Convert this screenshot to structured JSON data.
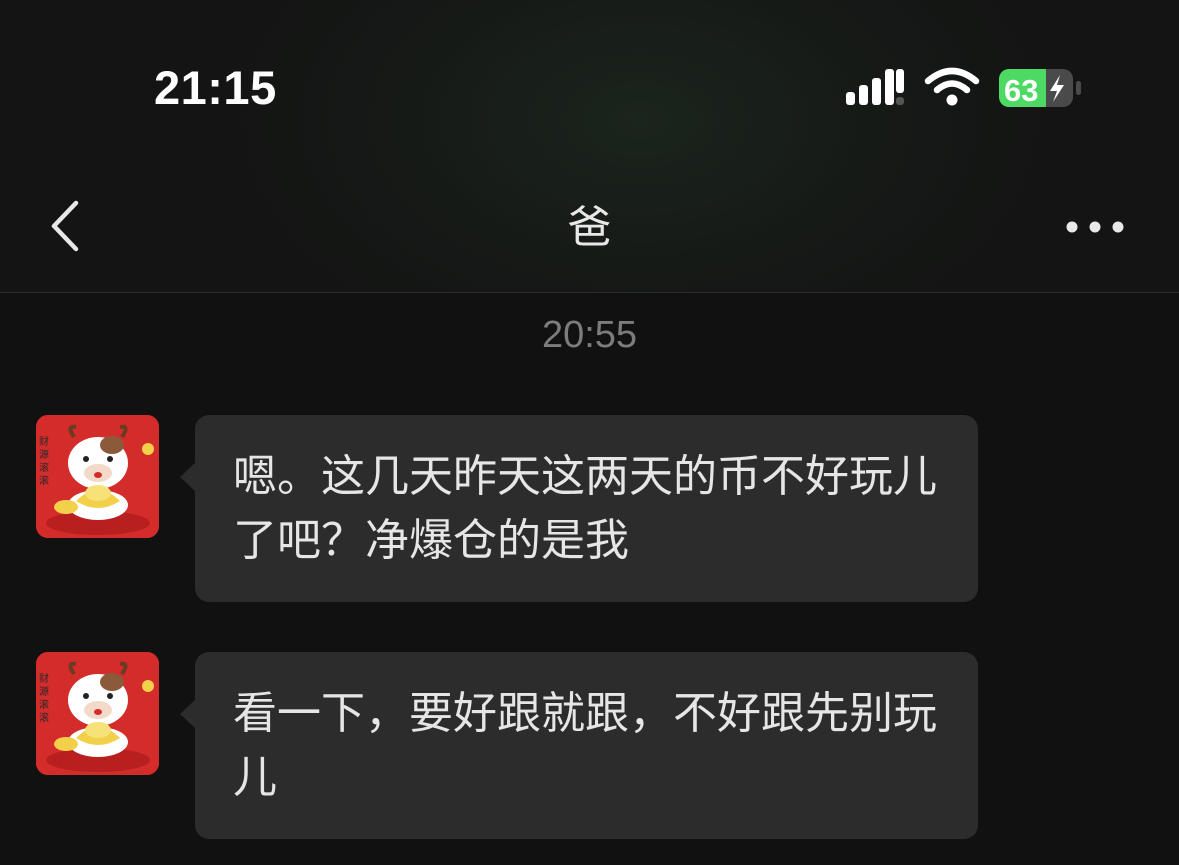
{
  "status_bar": {
    "time": "21:15",
    "battery_level": "63",
    "battery_fill_fraction": 0.63,
    "charging": true,
    "signal_icon": "cellular-signal-icon",
    "wifi_icon": "wifi-icon",
    "battery_color": "#4cd964"
  },
  "nav": {
    "title": "爸",
    "back_icon": "chevron-left-icon",
    "more_icon": "more-dots-icon"
  },
  "chat": {
    "timestamp": "20:55",
    "messages": [
      {
        "sender": "incoming",
        "avatar_icon": "ox-cartoon-avatar",
        "text": "嗯。这几天昨天这两天的币不好玩儿了吧？净爆仓的是我"
      },
      {
        "sender": "incoming",
        "avatar_icon": "ox-cartoon-avatar",
        "text": "看一下，要好跟就跟，不好跟先别玩儿"
      }
    ]
  },
  "theme": {
    "background": "#111111",
    "bubble_incoming": "#2c2c2c",
    "text_primary": "#e6e6e6",
    "timestamp_color": "#7c7c7c"
  }
}
